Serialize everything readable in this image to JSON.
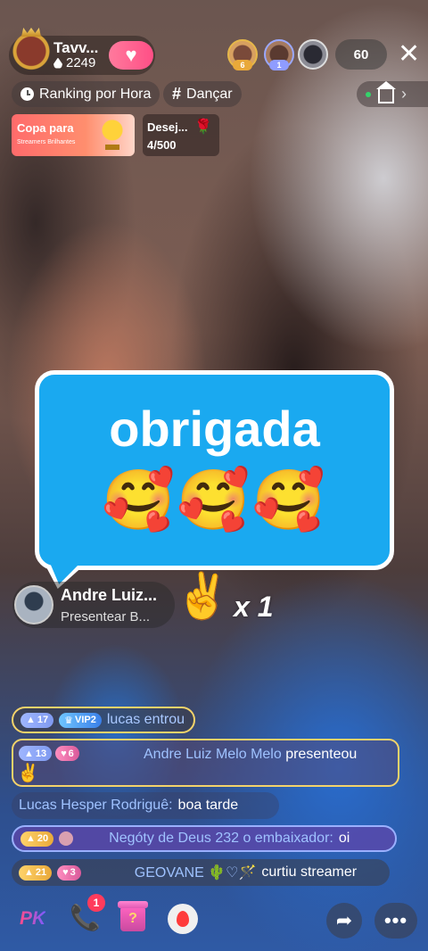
{
  "host": {
    "name": "Tavv...",
    "fans": "2249",
    "follow_icon": "heart-icon"
  },
  "viewers": {
    "badge1": "6",
    "badge2": "1",
    "count": "60"
  },
  "tags": {
    "ranking": "Ranking por Hora",
    "category": "Dançar"
  },
  "events": {
    "copa_title": "Copa para",
    "copa_sub": "Streamers Brilhantes",
    "wish_title": "Desej...",
    "wish_progress": "4/500"
  },
  "bubble": {
    "text": "obrigada",
    "emojis": "🥰🥰🥰",
    "color": "#1aa9f0"
  },
  "gift_notice": {
    "name": "Andre Luiz...",
    "action": "Presentear B...",
    "gift_icon": "✌️",
    "multiplier": "x 1"
  },
  "chat": [
    {
      "lvl": "17",
      "vip": "VIP2",
      "text": "lucas entrou"
    },
    {
      "lvl": "13",
      "lvl2": "6",
      "user": "Andre Luiz Melo Melo",
      "text": "presenteou",
      "gift": "✌️"
    },
    {
      "user": "Lucas Hesper Rodriguê:",
      "text": "boa tarde"
    },
    {
      "lvl": "20",
      "user": "Negóty de Deus 232 o embaixador:",
      "text": "oi"
    },
    {
      "lvl": "21",
      "lvl2": "3",
      "user": "GEOVANE 🌵♡🪄",
      "text": "curtiu streamer"
    }
  ],
  "bottom": {
    "pk": "PK",
    "call_badge": "1",
    "giftbox": "?"
  }
}
